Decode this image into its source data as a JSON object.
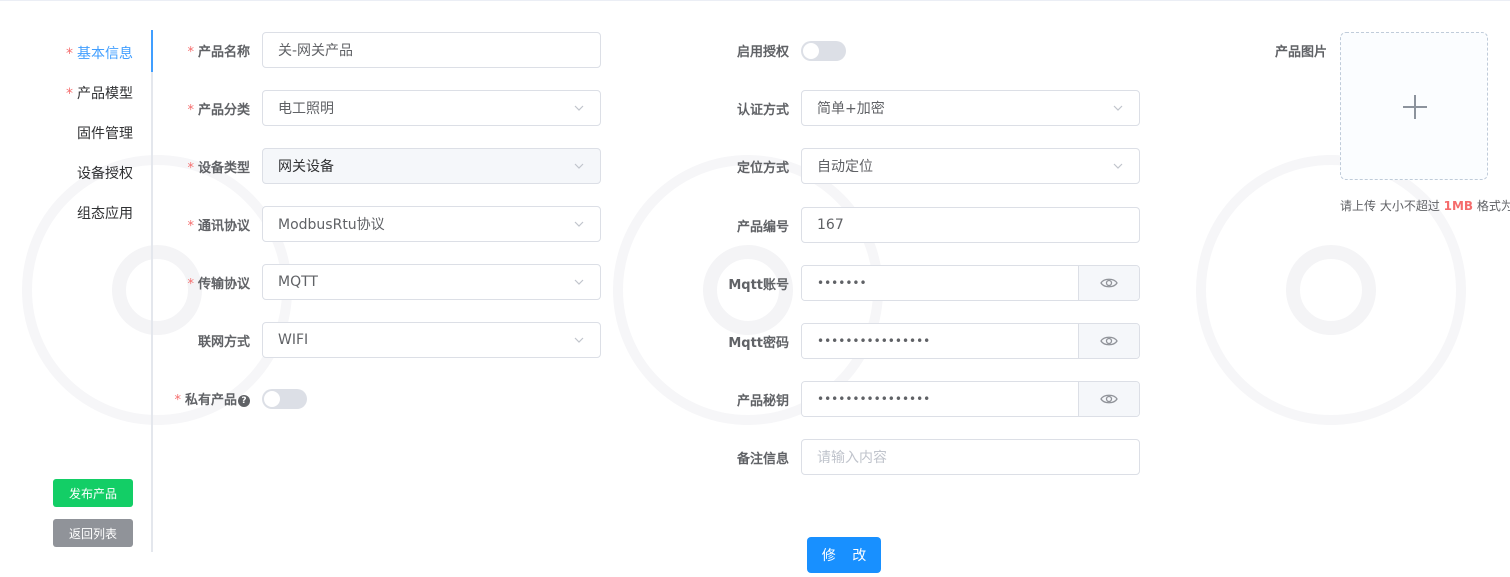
{
  "tabs": [
    {
      "label": "基本信息",
      "required": "*"
    },
    {
      "label": "产品模型",
      "required": "*"
    },
    {
      "label": "固件管理"
    },
    {
      "label": "设备授权"
    },
    {
      "label": "组态应用"
    }
  ],
  "side_buttons": {
    "publish": "发布产品",
    "back": "返回列表"
  },
  "form_left": {
    "product_name": {
      "label": "产品名称",
      "value": "关-网关产品"
    },
    "category": {
      "label": "产品分类",
      "value": "电工照明"
    },
    "device_type": {
      "label": "设备类型",
      "value": "网关设备"
    },
    "protocol": {
      "label": "通讯协议",
      "value": "ModbusRtu协议"
    },
    "transport": {
      "label": "传输协议",
      "value": "MQTT"
    },
    "network": {
      "label": "联网方式",
      "value": "WIFI"
    },
    "private": {
      "label": "私有产品",
      "help": "?"
    }
  },
  "form_mid": {
    "auth_enable": {
      "label": "启用授权"
    },
    "auth_method": {
      "label": "认证方式",
      "value": "简单+加密"
    },
    "location": {
      "label": "定位方式",
      "value": "自动定位"
    },
    "product_no": {
      "label": "产品编号",
      "value": "167"
    },
    "mqtt_account": {
      "label": "Mqtt账号",
      "value": "•••••••"
    },
    "mqtt_password": {
      "label": "Mqtt密码",
      "value": "••••••••••••••••"
    },
    "product_secret": {
      "label": "产品秘钥",
      "value": "••••••••••••••••"
    },
    "remark": {
      "label": "备注信息",
      "placeholder": "请输入内容"
    }
  },
  "image": {
    "label": "产品图片",
    "tip_prefix": "请上传 大小不超过 ",
    "tip_size": "1MB",
    "tip_suffix": " 格式为"
  },
  "submit_label": "修 改",
  "colors": {
    "primary": "#409eff",
    "submit": "#1890ff",
    "publish": "#13ce66",
    "back": "#909399",
    "required": "#f56c6c"
  }
}
